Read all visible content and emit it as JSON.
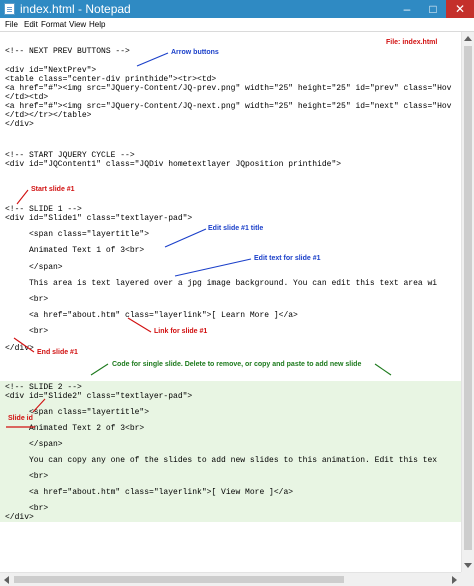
{
  "window": {
    "title": "index.html - Notepad",
    "controls": {
      "minimize": "–",
      "maximize": "□",
      "close": "✕"
    }
  },
  "menu": [
    "File",
    "Edit",
    "Format",
    "View",
    "Help"
  ],
  "code_lines": [
    "<!-- NEXT PREV BUTTONS -->",
    "<div id=\"NextPrev\">",
    "<table class=\"center-div printhide\"><tr><td>",
    "<a href=\"#\"><img src=\"JQuery-Content/JQ-prev.png\" width=\"25\" height=\"25\" id=\"prev\" class=\"Hov",
    "</td><td>",
    "<a href=\"#\"><img src=\"JQuery-Content/JQ-next.png\" width=\"25\" height=\"25\" id=\"next\" class=\"Hov",
    "</td></tr></table>",
    "</div>",
    "<!-- START JQUERY CYCLE -->",
    "<div id=\"JQContent1\" class=\"JQDiv hometextlayer JQposition printhide\">",
    "<!-- SLIDE 1 -->",
    "<div id=\"Slide1\" class=\"textlayer-pad\">",
    "     <span class=\"layertitle\">",
    "     Animated Text 1 of 3<br>",
    "     </span>",
    "     This area is text layered over a jpg image background. You can edit this text area wi",
    "     <br>",
    "     <a href=\"about.htm\" class=\"layerlink\">[ Learn More ]</a>",
    "     <br>",
    "</div>",
    "<!-- SLIDE 2 -->",
    "<div id=\"Slide2\" class=\"textlayer-pad\">",
    "     <span class=\"layertitle\">",
    "     Animated Text 2 of 3<br>",
    "     </span>",
    "     You can copy any one of the slides to add new slides to this animation. Edit this tex",
    "     <br>",
    "     <a href=\"about.htm\" class=\"layerlink\">[ View More ]</a>",
    "     <br>",
    "</div>"
  ],
  "annotations": {
    "file_label": "File: index.html",
    "arrow_buttons": "Arrow buttons",
    "start_slide": "Start slide #1",
    "edit_title": "Edit slide #1 title",
    "edit_text": "Edit text for slide #1",
    "link_slide": "Link for slide #1",
    "end_slide": "End slide #1",
    "code_single_slide": "Code for single slide. Delete to remove, or copy and paste to add new slide",
    "slide_id": "Slide id"
  },
  "colors": {
    "titlebar": "#2f8ac3",
    "close_button": "#c4302b",
    "blue_annotation": "#1a3fc9",
    "red_annotation": "#d11010",
    "green_annotation": "#1d7a1d",
    "highlight": "#e8f5e3"
  }
}
